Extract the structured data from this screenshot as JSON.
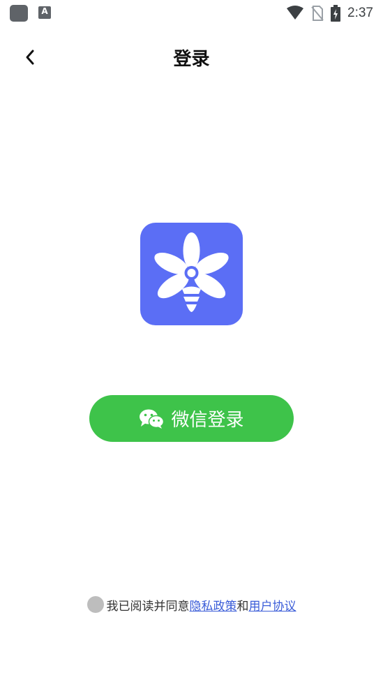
{
  "status_bar": {
    "time": "2:37",
    "a_icon_label": "A"
  },
  "header": {
    "title": "登录"
  },
  "login": {
    "wechat_button_label": "微信登录"
  },
  "agreement": {
    "prefix": "我已阅读并同意",
    "privacy_link": "隐私政策",
    "conjunction": "和",
    "terms_link": "用户协议"
  },
  "colors": {
    "logo_bg": "#5b6ef5",
    "wechat_green": "#3ec34a",
    "link_blue": "#3a5cd8"
  }
}
